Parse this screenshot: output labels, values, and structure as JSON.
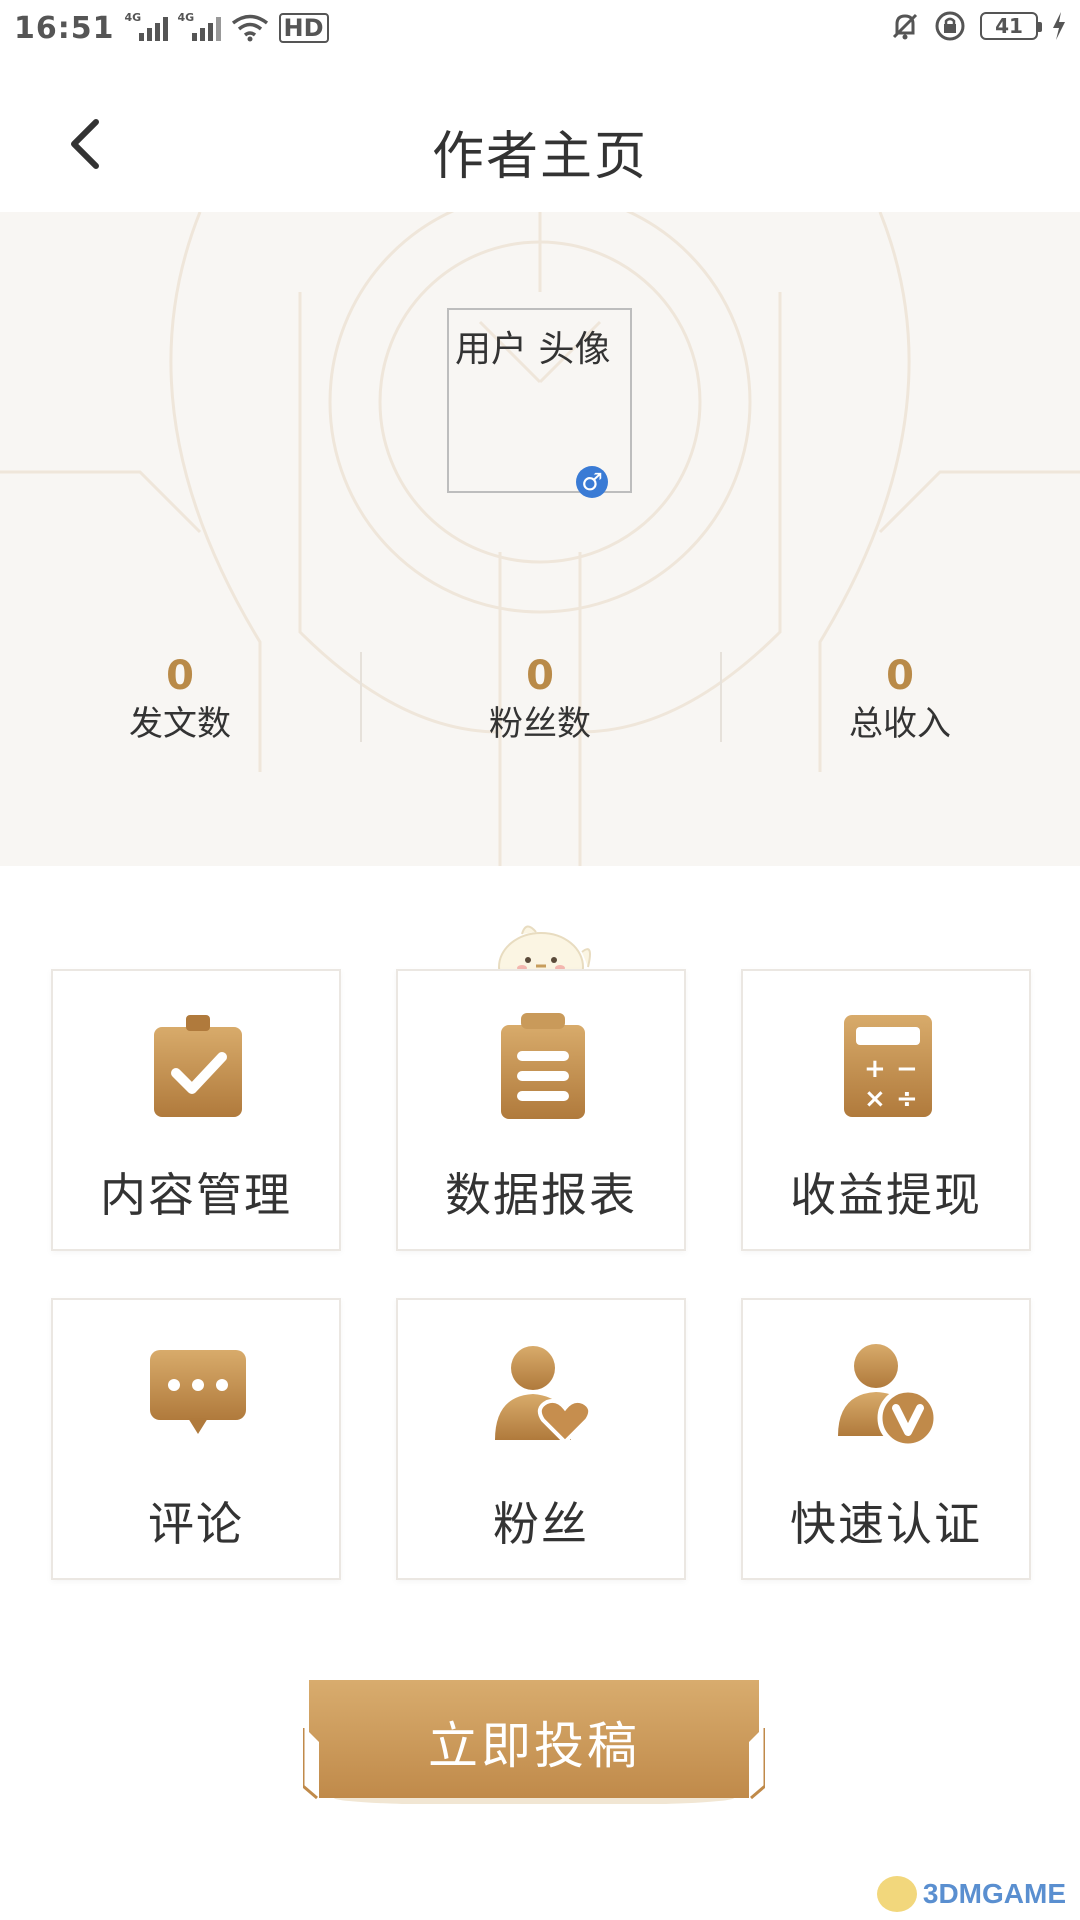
{
  "status_bar": {
    "time": "16:51",
    "network_1": "4G",
    "network_2": "4G",
    "hd_label": "HD",
    "battery": "41"
  },
  "header": {
    "title": "作者主页"
  },
  "profile": {
    "avatar_placeholder": "用户 头像",
    "gender_symbol": "♂"
  },
  "stats": [
    {
      "value": "0",
      "label": "发文数"
    },
    {
      "value": "0",
      "label": "粉丝数"
    },
    {
      "value": "0",
      "label": "总收入"
    }
  ],
  "menu": [
    {
      "label": "内容管理",
      "icon": "clipboard-check-icon"
    },
    {
      "label": "数据报表",
      "icon": "clipboard-list-icon"
    },
    {
      "label": "收益提现",
      "icon": "calculator-icon"
    },
    {
      "label": "评论",
      "icon": "comment-bubble-icon"
    },
    {
      "label": "粉丝",
      "icon": "user-heart-icon"
    },
    {
      "label": "快速认证",
      "icon": "user-verified-icon"
    }
  ],
  "submit_button": "立即投稿",
  "watermark": "3DMGAME",
  "colors": {
    "accent_gold": "#c0914f",
    "accent_gold_dark": "#a8753a",
    "gender_blue": "#3a7bd5"
  }
}
